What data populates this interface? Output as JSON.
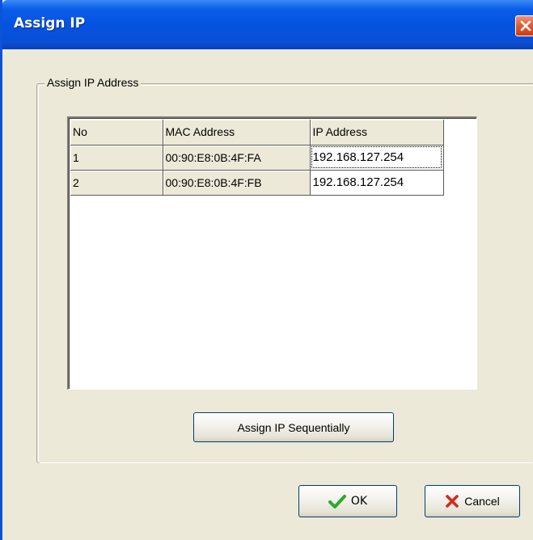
{
  "window": {
    "title": "Assign IP",
    "close_icon": "close-icon"
  },
  "group": {
    "label": "Assign IP Address"
  },
  "grid": {
    "columns": [
      "No",
      "MAC Address",
      "IP Address"
    ],
    "rows": [
      {
        "no": "1",
        "mac": "00:90:E8:0B:4F:FA",
        "ip": "192.168.127.254"
      },
      {
        "no": "2",
        "mac": "00:90:E8:0B:4F:FB",
        "ip": "192.168.127.254"
      }
    ]
  },
  "buttons": {
    "assign_sequential": "Assign IP Sequentially",
    "ok": "OK",
    "ok_icon": "checkmark-icon",
    "cancel": "Cancel",
    "cancel_icon": "x-icon"
  },
  "colors": {
    "titlebar": "#0453e0",
    "dialog_bg": "#ece9d8",
    "close_button": "#e05a33",
    "ok_check": "#2fa82f",
    "cancel_x": "#d42b1e"
  }
}
